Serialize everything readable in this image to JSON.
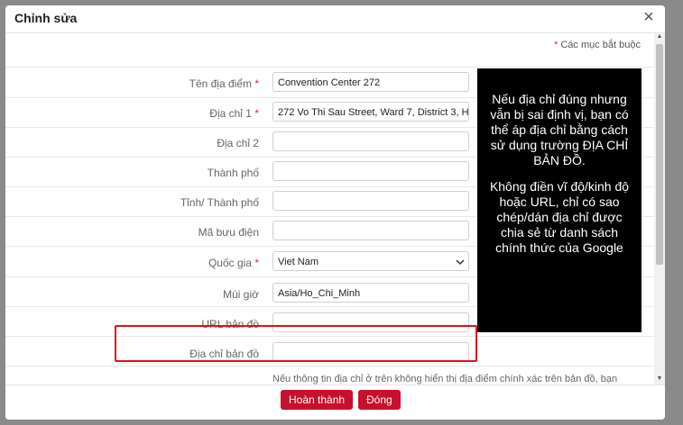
{
  "dialog": {
    "title": "Chỉnh sửa",
    "close_icon": "×"
  },
  "required_note": {
    "star": "*",
    "text": "Các mục bắt buộc"
  },
  "fields": {
    "ten_dia_diem": {
      "label": "Tên địa điểm",
      "required": "*",
      "value": "Convention Center 272"
    },
    "dia_chi_1": {
      "label": "Địa chỉ 1",
      "required": "*",
      "value": "272 Vo Thi Sau Street, Ward 7, District 3, H"
    },
    "dia_chi_2": {
      "label": "Địa chỉ 2",
      "value": ""
    },
    "thanh_pho": {
      "label": "Thành phố",
      "value": ""
    },
    "tinh": {
      "label": "Tỉnh/ Thành phố",
      "value": ""
    },
    "ma_buu_dien": {
      "label": "Mã bưu điện",
      "value": ""
    },
    "quoc_gia": {
      "label": "Quốc gia",
      "required": "*",
      "value": "Viet Nam"
    },
    "mui_gio": {
      "label": "Múi giờ",
      "value": "Asia/Ho_Chi_Minh"
    },
    "url_ban_do": {
      "label": "URL bản đồ",
      "value": ""
    },
    "dia_chi_ban_do": {
      "label": "Địa chỉ bản đồ",
      "value": ""
    }
  },
  "help_text": "Nếu thông tin địa chỉ ở trên không hiển thị địa điểm chính xác trên bản đồ, bạn",
  "tooltip": {
    "para1": "Nếu địa chỉ đúng nhưng vẫn bị sai định vị, bạn có thể áp địa chỉ bằng cách sử dụng trường ĐỊA CHỈ BẢN ĐỒ.",
    "para2": "Không điền vĩ độ/kinh độ hoặc URL, chỉ có sao chép/dán địa chỉ được chia sẻ từ danh sách chính thức của Google"
  },
  "footer": {
    "done_label": "Hoàn thành",
    "close_label": "Đóng"
  },
  "icons": {
    "close": "close-icon",
    "select_caret": "chevron-down-icon",
    "scroll_up": "arrow-up-icon",
    "scroll_down": "arrow-down-icon"
  },
  "colors": {
    "primary_button": "#c8102e",
    "required_star": "#d32f2f",
    "highlight_border": "#e01010",
    "tooltip_bg": "#000000"
  }
}
